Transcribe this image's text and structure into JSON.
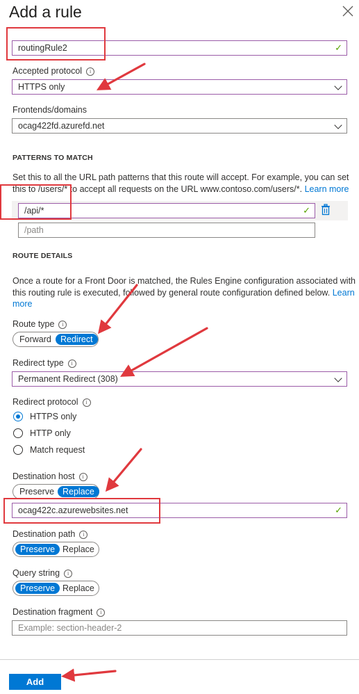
{
  "panel": {
    "title": "Add a rule",
    "close_icon": "close-icon"
  },
  "rule_name": {
    "value": "routingRule2"
  },
  "accepted_protocol": {
    "label": "Accepted protocol",
    "value": "HTTPS only"
  },
  "frontends": {
    "label": "Frontends/domains",
    "value": "ocag422fd.azurefd.net"
  },
  "patterns": {
    "heading": "PATTERNS TO MATCH",
    "description_line1": "Set this to all the URL path patterns that this route will accept. For example, you can set",
    "description_line2": "this to /users/* to accept all requests on the URL www.contoso.com/users/*.",
    "learn_more": "Learn more",
    "items": [
      "/api/*"
    ],
    "new_placeholder": "/path"
  },
  "route_details": {
    "heading": "ROUTE DETAILS",
    "description_line1": "Once a route for a Front Door is matched, the Rules Engine configuration associated with",
    "description_line2": "this routing rule is executed, followed by general route configuration defined below.",
    "learn": "Learn",
    "more": "more"
  },
  "route_type": {
    "label": "Route type",
    "options": [
      "Forward",
      "Redirect"
    ],
    "selected": "Redirect"
  },
  "redirect_type": {
    "label": "Redirect type",
    "value": "Permanent Redirect (308)"
  },
  "redirect_protocol": {
    "label": "Redirect protocol",
    "options": [
      "HTTPS only",
      "HTTP only",
      "Match request"
    ],
    "selected": "HTTPS only"
  },
  "destination_host": {
    "label": "Destination host",
    "options": [
      "Preserve",
      "Replace"
    ],
    "selected": "Replace",
    "value": "ocag422c.azurewebsites.net"
  },
  "destination_path": {
    "label": "Destination path",
    "options": [
      "Preserve",
      "Replace"
    ],
    "selected": "Preserve"
  },
  "query_string": {
    "label": "Query string",
    "options": [
      "Preserve",
      "Replace"
    ],
    "selected": "Preserve"
  },
  "destination_fragment": {
    "label": "Destination fragment",
    "placeholder": "Example: section-header-2"
  },
  "footer": {
    "add_label": "Add"
  },
  "colors": {
    "accent": "#0078d4",
    "valid_border": "#9b5ca8",
    "annotation": "#e0393e",
    "check": "#57a300"
  }
}
